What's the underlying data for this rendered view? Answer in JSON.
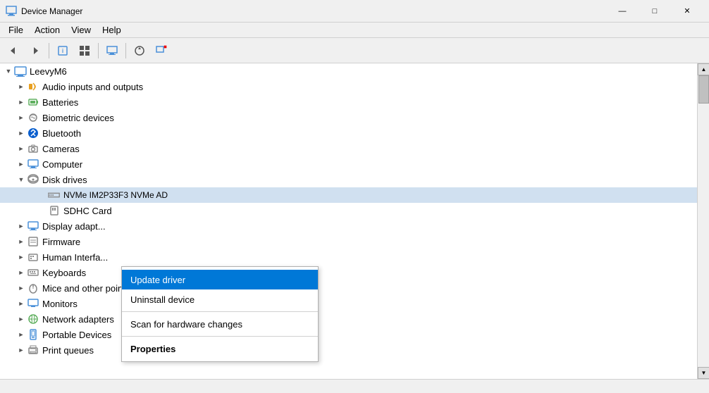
{
  "titleBar": {
    "title": "Device Manager",
    "iconUnicode": "🖥"
  },
  "windowControls": {
    "minimize": "—",
    "maximize": "□",
    "close": "✕"
  },
  "menu": {
    "items": [
      "File",
      "Action",
      "View",
      "Help"
    ]
  },
  "toolbar": {
    "buttons": [
      {
        "name": "back-btn",
        "icon": "◄",
        "interactable": true
      },
      {
        "name": "forward-btn",
        "icon": "►",
        "interactable": true
      },
      {
        "name": "up-btn",
        "icon": "▲",
        "interactable": true
      },
      {
        "name": "help-btn",
        "icon": "?",
        "interactable": true
      },
      {
        "name": "browse-btn",
        "icon": "⊞",
        "interactable": true
      },
      {
        "name": "monitor-btn",
        "icon": "🖥",
        "interactable": true
      },
      {
        "name": "scan-btn",
        "icon": "⟳",
        "interactable": true
      },
      {
        "name": "remove-btn",
        "icon": "✕",
        "interactable": true
      }
    ]
  },
  "tree": {
    "root": {
      "label": "LeevyM6",
      "expanded": true
    },
    "items": [
      {
        "id": "audio",
        "label": "Audio inputs and outputs",
        "indent": 1,
        "icon": "🎵",
        "iconType": "audio",
        "expandable": true,
        "expanded": false
      },
      {
        "id": "batteries",
        "label": "Batteries",
        "indent": 1,
        "icon": "🔋",
        "iconType": "battery",
        "expandable": true,
        "expanded": false
      },
      {
        "id": "biometric",
        "label": "Biometric devices",
        "indent": 1,
        "icon": "👁",
        "iconType": "biometric",
        "expandable": true,
        "expanded": false
      },
      {
        "id": "bluetooth",
        "label": "Bluetooth",
        "indent": 1,
        "icon": "⬡",
        "iconType": "bluetooth",
        "expandable": true,
        "expanded": false
      },
      {
        "id": "cameras",
        "label": "Cameras",
        "indent": 1,
        "icon": "📷",
        "iconType": "camera",
        "expandable": true,
        "expanded": false
      },
      {
        "id": "computer",
        "label": "Computer",
        "indent": 1,
        "icon": "💻",
        "iconType": "computer",
        "expandable": true,
        "expanded": false
      },
      {
        "id": "disk",
        "label": "Disk drives",
        "indent": 1,
        "icon": "💾",
        "iconType": "disk",
        "expandable": true,
        "expanded": true
      },
      {
        "id": "nvme",
        "label": "NVMe IM2P33F3 NVMe  AD",
        "indent": 2,
        "icon": "▬",
        "iconType": "nvme",
        "expandable": false,
        "expanded": false,
        "selected": true
      },
      {
        "id": "sdhc",
        "label": "SDHC Card",
        "indent": 2,
        "icon": "▬",
        "iconType": "nvme",
        "expandable": false,
        "expanded": false
      },
      {
        "id": "display",
        "label": "Display adapt...",
        "indent": 1,
        "icon": "🖥",
        "iconType": "display",
        "expandable": true,
        "expanded": false
      },
      {
        "id": "firmware",
        "label": "Firmware",
        "indent": 1,
        "icon": "⚙",
        "iconType": "firmware",
        "expandable": true,
        "expanded": false
      },
      {
        "id": "human",
        "label": "Human Interfa...",
        "indent": 1,
        "icon": "🖱",
        "iconType": "human",
        "expandable": true,
        "expanded": false
      },
      {
        "id": "keyboards",
        "label": "Keyboards",
        "indent": 1,
        "icon": "⌨",
        "iconType": "keyboard",
        "expandable": true,
        "expanded": false
      },
      {
        "id": "mice",
        "label": "Mice and other pointing devices",
        "indent": 1,
        "icon": "🖱",
        "iconType": "mice",
        "expandable": true,
        "expanded": false
      },
      {
        "id": "monitors",
        "label": "Monitors",
        "indent": 1,
        "icon": "🖥",
        "iconType": "monitor",
        "expandable": true,
        "expanded": false
      },
      {
        "id": "network",
        "label": "Network adapters",
        "indent": 1,
        "icon": "🌐",
        "iconType": "network",
        "expandable": true,
        "expanded": false
      },
      {
        "id": "portable",
        "label": "Portable Devices",
        "indent": 1,
        "icon": "📱",
        "iconType": "portable",
        "expandable": true,
        "expanded": false
      },
      {
        "id": "print",
        "label": "Print queues",
        "indent": 1,
        "icon": "🖨",
        "iconType": "print",
        "expandable": true,
        "expanded": false
      }
    ]
  },
  "contextMenu": {
    "items": [
      {
        "id": "update-driver",
        "label": "Update driver",
        "highlighted": true,
        "bold": false,
        "separator": false
      },
      {
        "id": "uninstall-device",
        "label": "Uninstall device",
        "highlighted": false,
        "bold": false,
        "separator": false
      },
      {
        "id": "sep1",
        "separator": true
      },
      {
        "id": "scan-hardware",
        "label": "Scan for hardware changes",
        "highlighted": false,
        "bold": false,
        "separator": false
      },
      {
        "id": "sep2",
        "separator": true
      },
      {
        "id": "properties",
        "label": "Properties",
        "highlighted": false,
        "bold": true,
        "separator": false
      }
    ]
  },
  "statusBar": {
    "text": ""
  }
}
